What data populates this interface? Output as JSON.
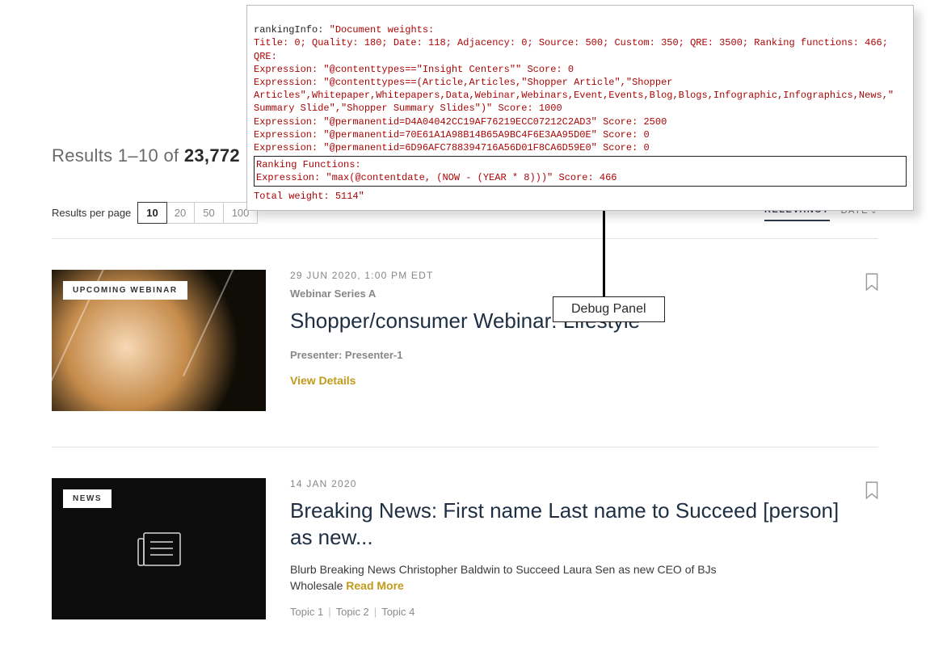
{
  "summary": {
    "label_prefix": "Results",
    "range": "1–10",
    "of": "of",
    "total": "23,772"
  },
  "perpage": {
    "label": "Results per page",
    "options": [
      "10",
      "20",
      "50",
      "100"
    ],
    "active": "10"
  },
  "sort": {
    "opt_relevancy": "RELEVANCY",
    "opt_date": "DATE"
  },
  "callout": {
    "label": "Debug Panel"
  },
  "debug": {
    "l1a": "rankingInfo: ",
    "l1b": "\"Document weights:",
    "l2": "Title: 0; Quality: 180; Date: 118; Adjacency: 0; Source: 500; Custom: 350; QRE: 3500; Ranking functions: 466;",
    "l3": "QRE:",
    "l4": "Expression: \"@contenttypes==\"Insight Centers\"\" Score: 0",
    "l5": "Expression: \"@contenttypes==(Article,Articles,\"Shopper Article\",\"Shopper",
    "l6": "Articles\",Whitepaper,Whitepapers,Data,Webinar,Webinars,Event,Events,Blog,Blogs,Infographic,Infographics,News,\"",
    "l7": "Summary Slide\",\"Shopper Summary Slides\")\" Score: 1000",
    "l8": "Expression: \"@permanentid=D4A04042CC19AF76219ECC07212C2AD3\" Score: 2500",
    "l9": "Expression: \"@permanentid=70E61A1A98B14B65A9BC4F6E3AA95D0E\" Score: 0",
    "l10": "Expression: \"@permanentid=6D96AFC788394716A56D01F8CA6D59E0\" Score: 0",
    "b1": "Ranking Functions:",
    "b2": "Expression: \"max(@contentdate, (NOW - (YEAR * 8)))\" Score: 466",
    "total": "Total weight: 5114\""
  },
  "cards": [
    {
      "badge": "UPCOMING WEBINAR",
      "date": "29 JUN 2020, 1:00 PM EDT",
      "series": "Webinar Series A",
      "title": "Shopper/consumer Webinar: Lifestyle",
      "presenter": "Presenter: Presenter-1",
      "view": "View Details"
    },
    {
      "badge": "NEWS",
      "date": "14 JAN 2020",
      "title": "Breaking News: First name Last name to Succeed [person] as new...",
      "blurb": "Blurb Breaking News Christopher Baldwin to Succeed Laura Sen as new CEO of BJs Wholesale ",
      "readmore": "Read More",
      "topics": [
        "Topic 1",
        "Topic 2",
        "Topic 4"
      ]
    }
  ]
}
